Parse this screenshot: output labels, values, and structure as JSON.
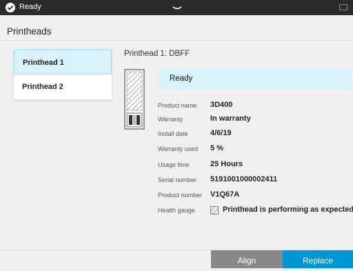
{
  "status_bar": {
    "status_text": "Ready",
    "icons": {
      "status": "check-circle-icon",
      "handle": "pull-down-handle-icon",
      "battery": "battery-icon"
    }
  },
  "header": {
    "title": "Printheads"
  },
  "sidebar": {
    "items": [
      {
        "label": "Printhead 1",
        "selected": true
      },
      {
        "label": "Printhead 2",
        "selected": false
      }
    ]
  },
  "detail": {
    "title": "Printhead 1: DBFF",
    "status_label": "Ready",
    "rows": [
      {
        "label": "Product name",
        "value": "3D400"
      },
      {
        "label": "Warranty",
        "value": "In warranty"
      },
      {
        "label": "Install date",
        "value": "4/6/19"
      },
      {
        "label": "Warranty used",
        "value": "5 %"
      },
      {
        "label": "Usage time",
        "value": "25 Hours"
      },
      {
        "label": "Serial number",
        "value": "5191001000002411"
      },
      {
        "label": "Product number",
        "value": "V1Q67A"
      }
    ],
    "health": {
      "label": "Health gauge",
      "value": "Printhead is performing as expected."
    }
  },
  "footer": {
    "align_label": "Align",
    "replace_label": "Replace"
  },
  "colors": {
    "accent": "#0096d6",
    "selected_bg": "#d8f3fb",
    "status_bar": "#2b2b2b",
    "align_button": "#888888"
  }
}
